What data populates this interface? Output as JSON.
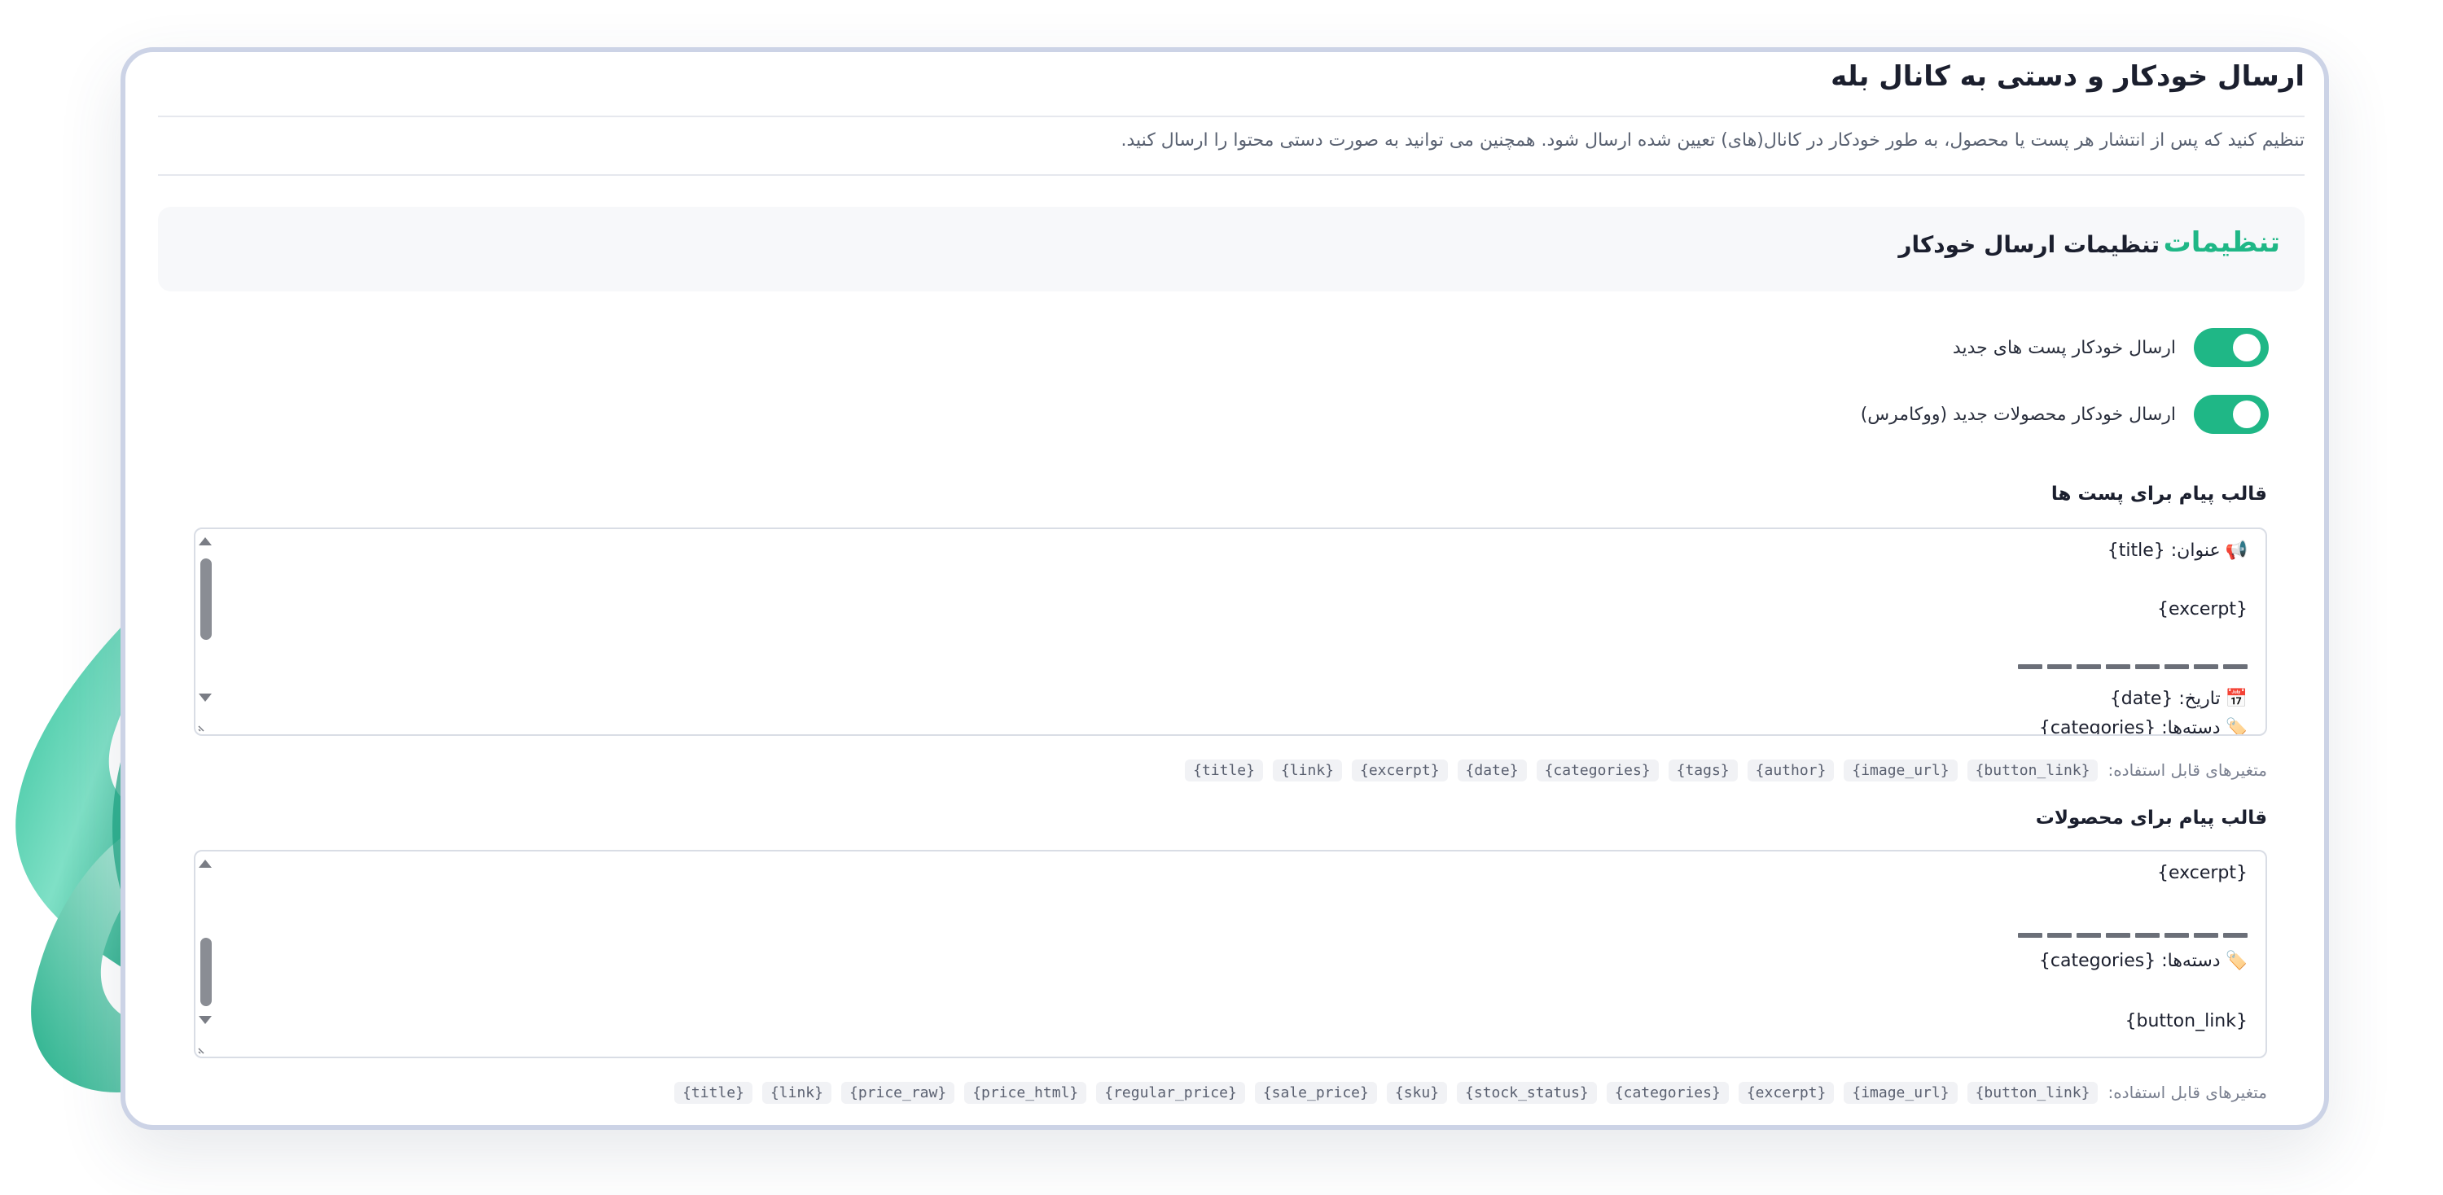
{
  "page": {
    "title": "ارسال خودکار و دستی به کانال بله",
    "description": "تنظیم کنید که پس از انتشار هر پست یا محصول، به طور خودکار در کانال(های) تعیین شده ارسال شود. همچنین می توانید به صورت دستی محتوا را ارسال کنید."
  },
  "settings": {
    "accent_label": "تنظیمات",
    "title": "تنظیمات ارسال خودکار",
    "toggles": [
      {
        "label": "ارسال خودکار پست های جدید",
        "on": true
      },
      {
        "label": "ارسال خودکار محصولات جدید (ووکامرس)",
        "on": true
      }
    ]
  },
  "post_template": {
    "label": "قالب پیام برای پست ها",
    "lines": [
      {
        "icon": "megaphone-icon",
        "glyph": "📢",
        "text": "عنوان: {title}"
      },
      {
        "text": "{excerpt}"
      },
      {
        "divider": "➖➖➖➖➖➖➖➖"
      },
      {
        "icon": "calendar-icon",
        "glyph": "📅",
        "text": "تاریخ: {date}"
      },
      {
        "icon": "tag-icon",
        "glyph": "🏷️",
        "text": "دسته‌ها: {categories}"
      }
    ],
    "vars_label": "متغیرهای قابل استفاده:",
    "vars": [
      "{button_link}",
      "{image_url}",
      "{author}",
      "{tags}",
      "{categories}",
      "{date}",
      "{excerpt}",
      "{link}",
      "{title}"
    ]
  },
  "product_template": {
    "label": "قالب پیام برای محصولات",
    "lines": [
      {
        "text": "{excerpt}"
      },
      {
        "divider": "➖➖➖➖➖➖➖➖"
      },
      {
        "icon": "tag-icon",
        "glyph": "🏷️",
        "text": "دسته‌ها: {categories}"
      },
      {
        "text": "{button_link}"
      }
    ],
    "vars_label": "متغیرهای قابل استفاده:",
    "vars": [
      "{button_link}",
      "{image_url}",
      "{excerpt}",
      "{categories}",
      "{stock_status}",
      "{sku}",
      "{sale_price}",
      "{regular_price}",
      "{price_html}",
      "{price_raw}",
      "{link}",
      "{title}"
    ]
  },
  "colors": {
    "accent": "#1fb786",
    "frame_border": "#ccd3e6",
    "header_bg": "#f7f8fa"
  }
}
